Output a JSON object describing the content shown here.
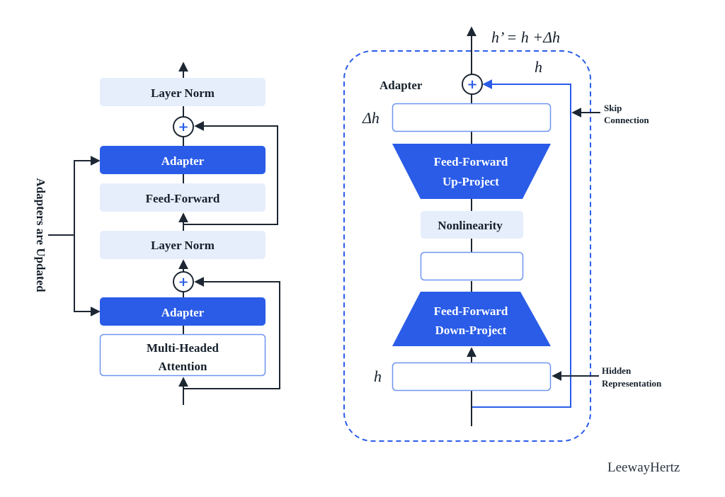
{
  "colors": {
    "accent_blue": "#2a5ce8",
    "light_box": "#e6eefc",
    "outline_blue": "#6e95f0",
    "line_dark": "#1d2733",
    "text_dark": "#15202b",
    "text_white": "#ffffff"
  },
  "left_stack": {
    "side_label": "Adapters are Updated",
    "top_layer_norm": "Layer Norm",
    "adapter_top": "Adapter",
    "feed_forward": "Feed-Forward",
    "mid_layer_norm": "Layer Norm",
    "adapter_bottom": "Adapter",
    "attention_line1": "Multi-Headed",
    "attention_line2": "Attention",
    "plus_symbol": "+"
  },
  "adapter_detail": {
    "title": "Adapter",
    "output_equation": "h’ = h +Δh",
    "skip_h_label": "h",
    "delta_h_label": "Δh",
    "input_h_label": "h",
    "up_project_line1": "Feed-Forward",
    "up_project_line2": "Up-Project",
    "nonlinearity": "Nonlinearity",
    "down_project_line1": "Feed-Forward",
    "down_project_line2": "Down-Project",
    "plus_symbol": "+",
    "skip_connection_line1": "Skip",
    "skip_connection_line2": "Connection",
    "hidden_rep_line1": "Hidden",
    "hidden_rep_line2": "Representation"
  },
  "brand": "LeewayHertz"
}
